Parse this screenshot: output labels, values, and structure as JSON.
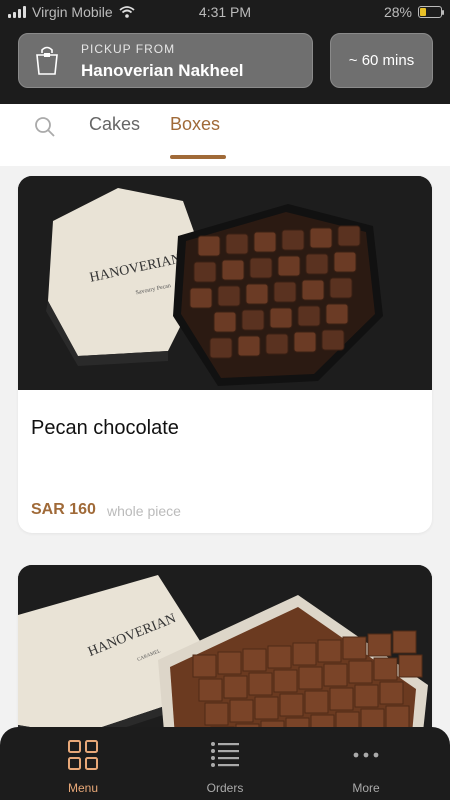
{
  "status_bar": {
    "carrier": "Virgin Mobile",
    "time": "4:31 PM",
    "battery": "28%",
    "battery_level": 0.28
  },
  "header": {
    "pickup_label": "PICKUP FROM",
    "pickup_location": "Hanoverian Nakheel",
    "eta": "~ 60 mins"
  },
  "tabs": {
    "search_icon": "search-icon",
    "items": [
      {
        "label": "Cakes",
        "active": false
      },
      {
        "label": "Boxes",
        "active": true
      }
    ]
  },
  "products": [
    {
      "title": "Pecan chocolate",
      "price": "SAR 160",
      "unit": "whole piece",
      "image_brand": "HANOVERIAN",
      "image_subtitle": "Savoury Pecan"
    },
    {
      "image_brand": "HANOVERIAN",
      "image_subtitle": "CARAMEL"
    }
  ],
  "bottom_nav": {
    "items": [
      {
        "label": "Menu",
        "icon": "grid-icon",
        "active": true
      },
      {
        "label": "Orders",
        "icon": "list-icon",
        "active": false
      },
      {
        "label": "More",
        "icon": "more-dots-icon",
        "active": false
      }
    ]
  },
  "colors": {
    "accent": "#a06a38",
    "header_bg": "#1c1c1c",
    "nav_active": "#e8a878"
  }
}
